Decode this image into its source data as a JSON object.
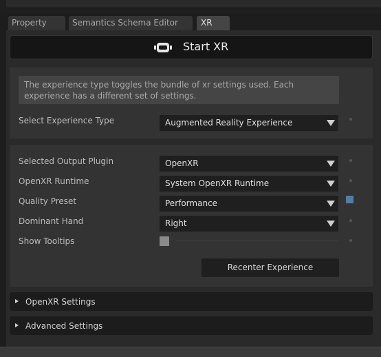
{
  "tabs": [
    {
      "label": "Property"
    },
    {
      "label": "Semantics Schema Editor"
    },
    {
      "label": "XR"
    }
  ],
  "start_button": {
    "label": "Start XR",
    "icon": "vr-headset-icon"
  },
  "info_text": "The experience type toggles the bundle of xr settings used. Each experience has a different set of settings.",
  "experience": {
    "label": "Select Experience Type",
    "value": "Augmented Reality Experience"
  },
  "settings": [
    {
      "label": "Selected Output Plugin",
      "value": "OpenXR"
    },
    {
      "label": "OpenXR Runtime",
      "value": "System OpenXR Runtime"
    },
    {
      "label": "Quality Preset",
      "value": "Performance"
    },
    {
      "label": "Dominant Hand",
      "value": "Right"
    }
  ],
  "show_tooltips": {
    "label": "Show Tooltips",
    "checked": false
  },
  "recenter_button": {
    "label": "Recenter Experience"
  },
  "collapsibles": [
    {
      "label": "OpenXR Settings"
    },
    {
      "label": "Advanced Settings"
    }
  ],
  "colors": {
    "accent_reset": "#4f7fa6",
    "panel_bg": "#2a2a2a"
  }
}
